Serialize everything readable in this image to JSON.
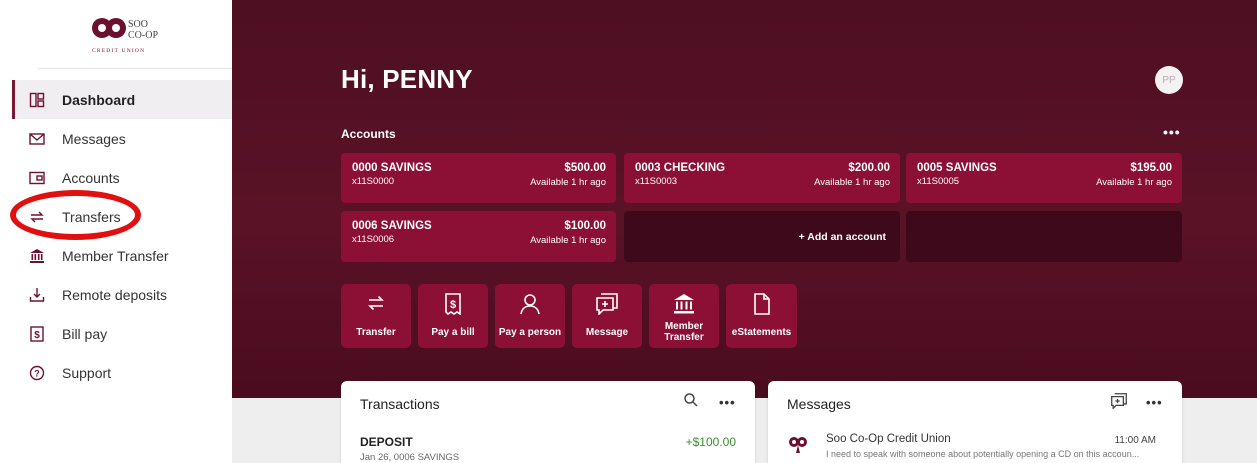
{
  "brand": {
    "logo_text_line1": "SOO",
    "logo_text_line2": "CO-OP",
    "logo_tagline": "CREDIT UNION",
    "primary_color": "#8c0f36",
    "dark_color": "#4e0f22"
  },
  "sidebar": {
    "items": [
      {
        "label": "Dashboard",
        "icon": "dashboard-icon",
        "active": true
      },
      {
        "label": "Messages",
        "icon": "mail-icon"
      },
      {
        "label": "Accounts",
        "icon": "wallet-icon"
      },
      {
        "label": "Transfers",
        "icon": "transfer-arrows-icon"
      },
      {
        "label": "Member Transfer",
        "icon": "bank-icon"
      },
      {
        "label": "Remote deposits",
        "icon": "deposit-download-icon"
      },
      {
        "label": "Bill pay",
        "icon": "dollar-bill-icon"
      },
      {
        "label": "Support",
        "icon": "help-circle-icon"
      }
    ]
  },
  "header": {
    "greeting": "Hi, PENNY",
    "avatar_initials": "PP"
  },
  "accounts": {
    "heading": "Accounts",
    "more": "•••",
    "items": [
      {
        "name": "0000 SAVINGS",
        "number": "x11S0000",
        "amount": "$500.00",
        "status": "Available 1 hr ago"
      },
      {
        "name": "0003 CHECKING",
        "number": "x11S0003",
        "amount": "$200.00",
        "status": "Available 1 hr ago"
      },
      {
        "name": "0005 SAVINGS",
        "number": "x11S0005",
        "amount": "$195.00",
        "status": "Available 1 hr ago"
      },
      {
        "name": "0006 SAVINGS",
        "number": "x11S0006",
        "amount": "$100.00",
        "status": "Available 1 hr ago"
      }
    ],
    "add_label": "+ Add an account"
  },
  "quick_actions": [
    {
      "label": "Transfer",
      "icon": "transfer-arrows-icon"
    },
    {
      "label": "Pay a bill",
      "icon": "dollar-bill-icon"
    },
    {
      "label": "Pay a person",
      "icon": "person-icon"
    },
    {
      "label": "Message",
      "icon": "compose-message-icon"
    },
    {
      "label_line1": "Member",
      "label_line2": "Transfer",
      "icon": "bank-icon"
    },
    {
      "label": "eStatements",
      "icon": "document-icon"
    }
  ],
  "transactions": {
    "title": "Transactions",
    "more": "•••",
    "items": [
      {
        "name": "DEPOSIT",
        "sub": "Jan 26, 0006 SAVINGS",
        "amount": "+$100.00"
      }
    ]
  },
  "messages": {
    "title": "Messages",
    "more": "•••",
    "items": [
      {
        "from": "Soo Co-Op Credit Union",
        "time": "11:00 AM",
        "preview": "I need to speak with someone about potentially opening a CD on this accoun..."
      }
    ]
  }
}
